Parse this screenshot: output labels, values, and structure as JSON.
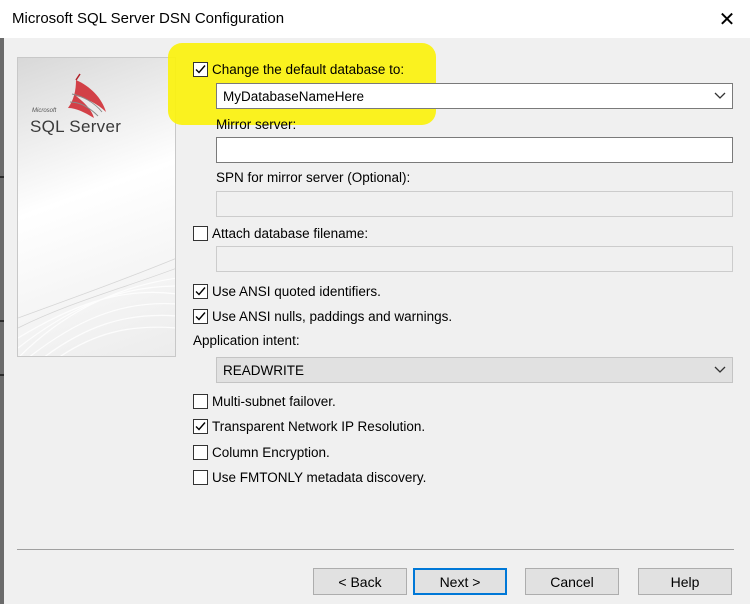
{
  "window": {
    "title": "Microsoft SQL Server DSN Configuration",
    "close_glyph": "✕"
  },
  "banner": {
    "brand_small": "Microsoft",
    "brand": "SQL Server",
    "logo_icon": "sql-server-logo-icon"
  },
  "form": {
    "change_default_db": {
      "label": "Change the default database to:",
      "checked": true
    },
    "default_db_value": "MyDatabaseNameHere",
    "mirror_server_label": "Mirror server:",
    "mirror_server_value": "",
    "spn_label": "SPN for mirror server (Optional):",
    "spn_value": "",
    "attach_db": {
      "label": "Attach database filename:",
      "checked": false
    },
    "attach_db_value": "",
    "ansi_quoted": {
      "label": "Use ANSI quoted identifiers.",
      "checked": true
    },
    "ansi_nulls": {
      "label": "Use ANSI nulls, paddings and warnings.",
      "checked": true
    },
    "app_intent_label": "Application intent:",
    "app_intent_value": "READWRITE",
    "multi_subnet": {
      "label": "Multi-subnet failover.",
      "checked": false
    },
    "tnir": {
      "label": "Transparent Network IP Resolution.",
      "checked": true
    },
    "column_encryption": {
      "label": "Column Encryption.",
      "checked": false
    },
    "fmtonly": {
      "label": "Use FMTONLY metadata discovery.",
      "checked": false
    }
  },
  "buttons": {
    "back": "< Back",
    "next": "Next >",
    "cancel": "Cancel",
    "help": "Help"
  },
  "colors": {
    "highlight": "#fbf20f",
    "logo_red": "#d0323a",
    "default_button_border": "#0078d7"
  }
}
